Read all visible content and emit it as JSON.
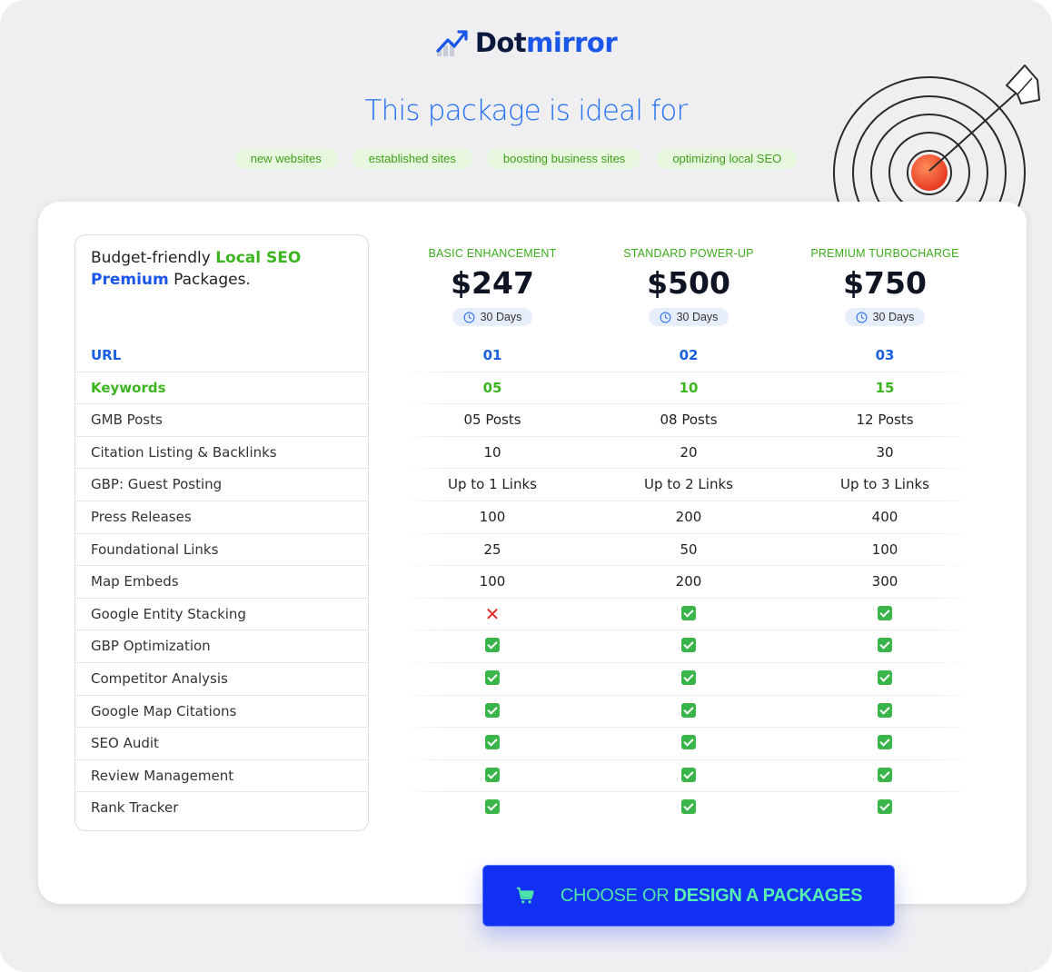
{
  "brand": {
    "logo_dark": "Dot",
    "logo_accent": "mirror"
  },
  "headline": "This package is ideal for",
  "tags": [
    "new websites",
    "established sites",
    "boosting business sites",
    "optimizing local SEO"
  ],
  "intro": {
    "part1": "Budget-friendly ",
    "green": "Local SEO",
    "blue": "Premium",
    "part2": " Packages."
  },
  "plans": [
    {
      "name": "BASIC ENHANCEMENT",
      "price": "$247",
      "duration": "30 Days"
    },
    {
      "name": "STANDARD POWER-UP",
      "price": "$500",
      "duration": "30 Days"
    },
    {
      "name": "PREMIUM TURBOCHARGE",
      "price": "$750",
      "duration": "30 Days"
    }
  ],
  "features": [
    {
      "label": "URL",
      "style": "blue",
      "values": [
        "01",
        "02",
        "03"
      ]
    },
    {
      "label": "Keywords",
      "style": "green",
      "values": [
        "05",
        "10",
        "15"
      ]
    },
    {
      "label": "GMB Posts",
      "values": [
        "05 Posts",
        "08 Posts",
        "12 Posts"
      ]
    },
    {
      "label": "Citation Listing & Backlinks",
      "values": [
        "10",
        "20",
        "30"
      ]
    },
    {
      "label": "GBP: Guest Posting",
      "values": [
        "Up to 1 Links",
        "Up to 2 Links",
        "Up to 3 Links"
      ]
    },
    {
      "label": "Press Releases",
      "values": [
        "100",
        "200",
        "400"
      ]
    },
    {
      "label": "Foundational Links",
      "values": [
        "25",
        "50",
        "100"
      ]
    },
    {
      "label": "Map Embeds",
      "values": [
        "100",
        "200",
        "300"
      ]
    },
    {
      "label": "Google Entity Stacking",
      "values": [
        "cross",
        "check",
        "check"
      ]
    },
    {
      "label": "GBP Optimization",
      "values": [
        "check",
        "check",
        "check"
      ]
    },
    {
      "label": "Competitor Analysis",
      "values": [
        "check",
        "check",
        "check"
      ]
    },
    {
      "label": "Google Map Citations",
      "values": [
        "check",
        "check",
        "check"
      ]
    },
    {
      "label": "SEO Audit",
      "values": [
        "check",
        "check",
        "check"
      ]
    },
    {
      "label": "Review Management",
      "values": [
        "check",
        "check",
        "check"
      ]
    },
    {
      "label": "Rank Tracker",
      "values": [
        "check",
        "check",
        "check"
      ]
    }
  ],
  "cta": {
    "prefix": "CHOOSE OR ",
    "bold": "DESIGN A PACKAGES"
  },
  "colors": {
    "accent_blue": "#1a56e8",
    "accent_green": "#3cb521",
    "cta_bg": "#1230f2",
    "cta_text": "#4ee3a8"
  }
}
